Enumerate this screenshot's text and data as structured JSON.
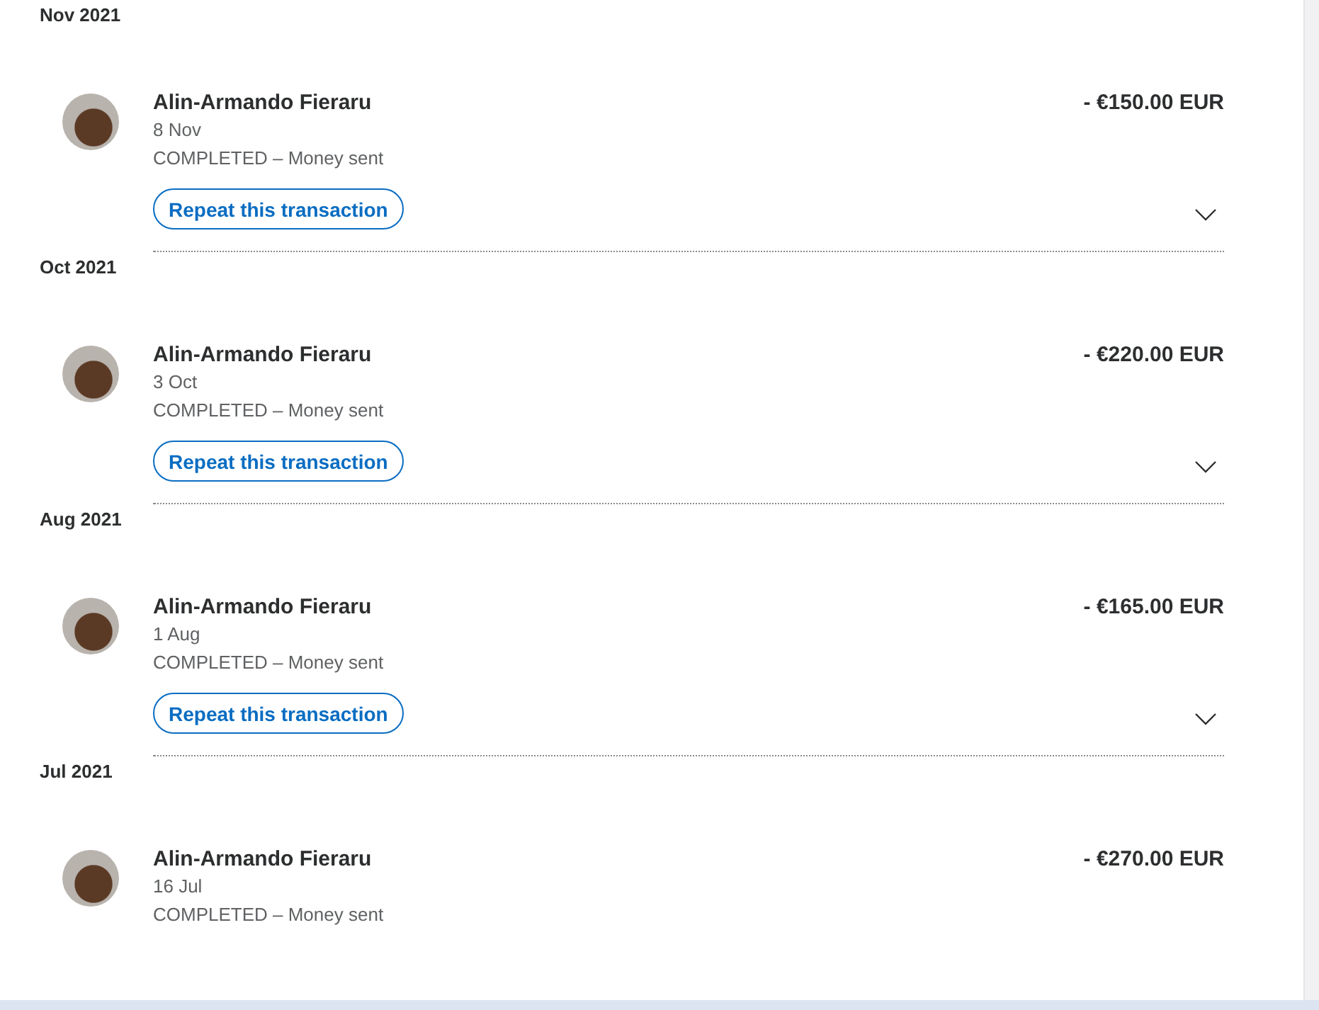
{
  "months": [
    {
      "label": "Nov 2021",
      "transactions": [
        {
          "name": "Alin-Armando Fieraru",
          "date": "8 Nov",
          "status": "COMPLETED – Money sent",
          "amount": "- €150.00 EUR",
          "action": "Repeat this transaction",
          "expanded": false
        }
      ]
    },
    {
      "label": "Oct 2021",
      "transactions": [
        {
          "name": "Alin-Armando Fieraru",
          "date": "3 Oct",
          "status": "COMPLETED – Money sent",
          "amount": "- €220.00 EUR",
          "action": "Repeat this transaction",
          "expanded": false
        }
      ]
    },
    {
      "label": "Aug 2021",
      "transactions": [
        {
          "name": "Alin-Armando Fieraru",
          "date": "1 Aug",
          "status": "COMPLETED – Money sent",
          "amount": "- €165.00 EUR",
          "action": "Repeat this transaction",
          "expanded": false
        }
      ]
    },
    {
      "label": "Jul 2021",
      "transactions": [
        {
          "name": "Alin-Armando Fieraru",
          "date": "16 Jul",
          "status": "COMPLETED – Money sent",
          "amount": "- €270.00 EUR"
        }
      ]
    }
  ]
}
